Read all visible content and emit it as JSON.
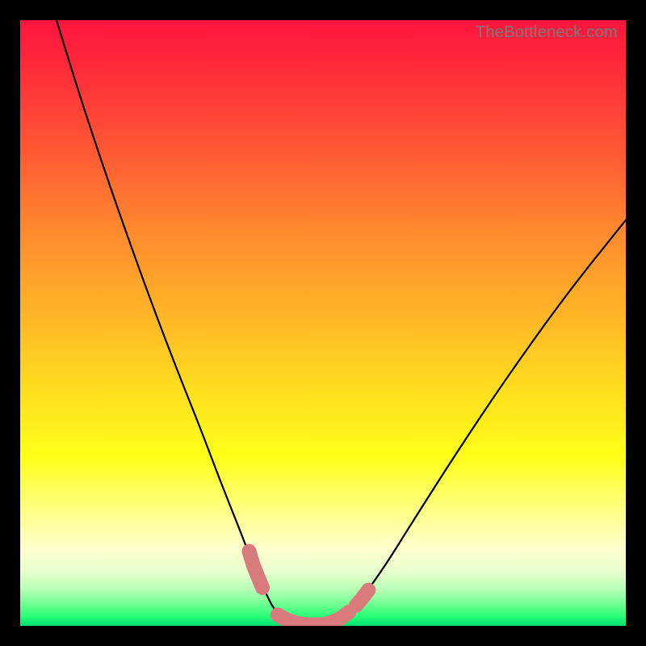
{
  "watermark": "TheBottleneck.com",
  "chart_data": {
    "type": "line",
    "title": "",
    "xlabel": "",
    "ylabel": "",
    "xlim": [
      0,
      100
    ],
    "ylim": [
      0,
      100
    ],
    "series": [
      {
        "name": "bottleneck-curve",
        "x": [
          6,
          10,
          14,
          18,
          22,
          26,
          30,
          33,
          36,
          38.5,
          40.5,
          42,
          44,
          47,
          50,
          53,
          56,
          60,
          65,
          72,
          80,
          90,
          100
        ],
        "y": [
          100,
          87,
          75,
          63.5,
          52.5,
          42,
          32,
          24,
          16.5,
          10,
          5.5,
          2.5,
          1,
          0.2,
          0.2,
          1.3,
          4,
          9.5,
          17.5,
          28.5,
          40.5,
          54.5,
          67
        ]
      }
    ],
    "markers": [
      {
        "name": "highlight-segments",
        "color": "#d97a7d",
        "segments": [
          {
            "x": [
              37.8,
              38.5,
              39.3,
              40.0
            ],
            "y": [
              12.3,
              10.0,
              8.0,
              6.3
            ]
          },
          {
            "x": [
              42.5,
              44.0,
              45.5,
              47.0,
              48.5,
              50.0,
              51.5,
              53.0,
              54.3
            ],
            "y": [
              1.8,
              1.0,
              0.5,
              0.2,
              0.2,
              0.2,
              0.6,
              1.3,
              2.3
            ]
          },
          {
            "x": [
              55.5,
              56.5,
              57.5
            ],
            "y": [
              3.4,
              4.6,
              5.9
            ]
          }
        ]
      }
    ]
  }
}
